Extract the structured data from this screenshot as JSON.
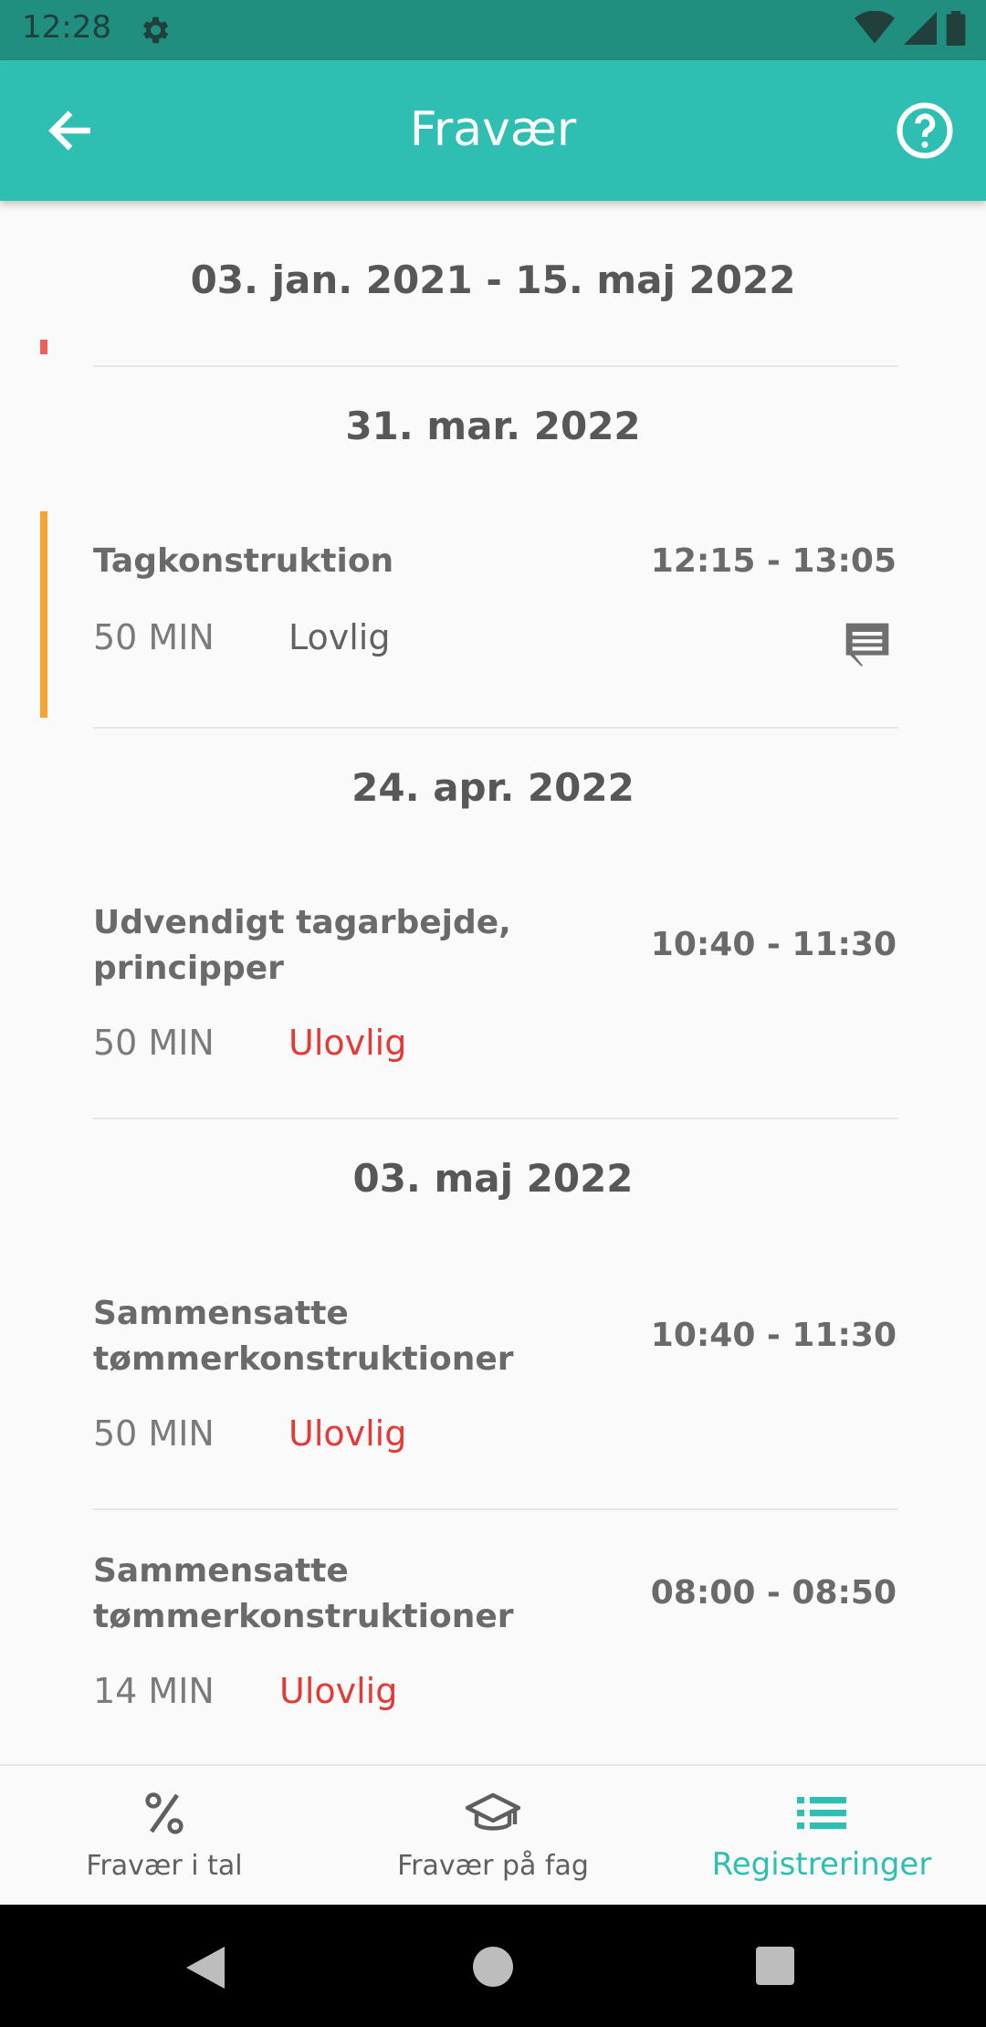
{
  "status_bar": {
    "time": "12:28",
    "icons": [
      "gear-icon",
      "wifi-icon",
      "signal-icon",
      "battery-icon"
    ]
  },
  "app_bar": {
    "title": "Fravær",
    "back_icon": "arrow-left-icon",
    "help_icon": "help-circle-icon"
  },
  "date_range": "03. jan. 2021  -  15. maj 2022",
  "groups": [
    {
      "date": "31. mar. 2022",
      "entries": [
        {
          "subject": "Tagkonstruktion",
          "time": "12:15 - 13:05",
          "minutes": "50 MIN",
          "status": "Lovlig",
          "has_comment": true
        }
      ]
    },
    {
      "date": "24. apr. 2022",
      "entries": [
        {
          "subject": "Udvendigt tagarbejde, principper",
          "time": "10:40 - 11:30",
          "minutes": "50 MIN",
          "status": "Ulovlig",
          "has_comment": false
        }
      ]
    },
    {
      "date": "03. maj 2022",
      "entries": [
        {
          "subject": "Sammensatte tømmerkonstruktioner",
          "time": "10:40 - 11:30",
          "minutes": "50 MIN",
          "status": "Ulovlig",
          "has_comment": false
        },
        {
          "subject": "Sammensatte tømmerkonstruktioner",
          "time": "08:00 - 08:50",
          "minutes": "14 MIN",
          "status": "Ulovlig",
          "has_comment": false
        }
      ]
    }
  ],
  "bottom_nav": {
    "items": [
      {
        "label": "Fravær i tal",
        "icon": "percent-icon",
        "active": false
      },
      {
        "label": "Fravær på fag",
        "icon": "graduation-cap-icon",
        "active": false
      },
      {
        "label": "Registreringer",
        "icon": "list-icon",
        "active": true
      }
    ]
  },
  "colors": {
    "accent": "#2ebfb2",
    "status_bar": "#208f80",
    "illegal": "#e53935",
    "legal_marker": "#f5a534"
  }
}
